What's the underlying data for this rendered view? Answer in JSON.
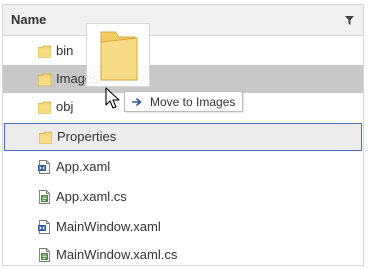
{
  "header": {
    "title": "Name",
    "filter_icon": "filter-icon"
  },
  "rows": [
    {
      "label": "bin",
      "icon": "folder-icon"
    },
    {
      "label": "Images",
      "icon": "folder-icon",
      "state": "hovered"
    },
    {
      "label": "obj",
      "icon": "folder-icon"
    },
    {
      "label": "Properties",
      "icon": "folder-icon",
      "state": "current"
    },
    {
      "label": "App.xaml",
      "icon": "xaml-file-icon"
    },
    {
      "label": "App.xaml.cs",
      "icon": "cs-file-icon"
    },
    {
      "label": "MainWindow.xaml",
      "icon": "xaml-file-icon"
    },
    {
      "label": "MainWindow.xaml.cs",
      "icon": "cs-file-icon"
    }
  ],
  "drag": {
    "preview_icon": "folder-icon",
    "tooltip_icon": "arrow-right-icon",
    "tooltip_text": "Move to Images"
  },
  "colors": {
    "header_bg": "#f0f0f0",
    "hover_bg": "#c8c8c8",
    "current_bg": "#ececec",
    "current_border": "#4f6dbd",
    "folder_yellow": "#f5d374",
    "accent_blue": "#2b579a"
  }
}
